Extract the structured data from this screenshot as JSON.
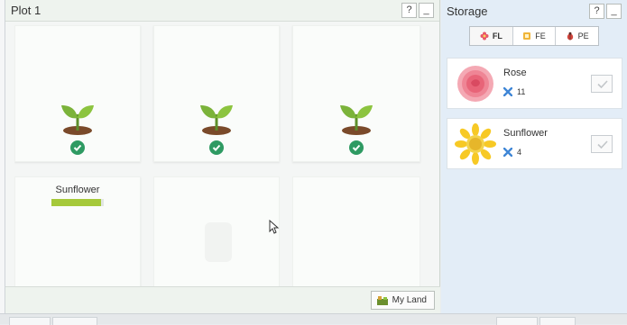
{
  "plot": {
    "title": "Plot 1",
    "help_label": "?",
    "minimize_label": "_",
    "tiles": [
      {
        "status": "ready",
        "crop": ""
      },
      {
        "status": "ready",
        "crop": ""
      },
      {
        "status": "ready",
        "crop": ""
      },
      {
        "status": "growing",
        "crop": "Sunflower",
        "progress": 0.95
      },
      {
        "status": "empty",
        "crop": ""
      },
      {
        "status": "empty",
        "crop": ""
      }
    ],
    "growing_crop": "Sunflower",
    "my_land_label": "My Land"
  },
  "storage": {
    "title": "Storage",
    "help_label": "?",
    "minimize_label": "_",
    "tabs": [
      {
        "label": "FL",
        "icon": "flower-icon",
        "active": true
      },
      {
        "label": "FE",
        "icon": "fertilizer-icon",
        "active": false
      },
      {
        "label": "PE",
        "icon": "pest-icon",
        "active": false
      }
    ],
    "items": [
      {
        "name": "Rose",
        "qty": "11",
        "icon": "rose-icon"
      },
      {
        "name": "Sunflower",
        "qty": "4",
        "icon": "sunflower-icon"
      }
    ]
  },
  "colors": {
    "check_green": "#2e9a62",
    "progress_green": "#a5c93a",
    "storage_bg": "#e3edf7"
  }
}
